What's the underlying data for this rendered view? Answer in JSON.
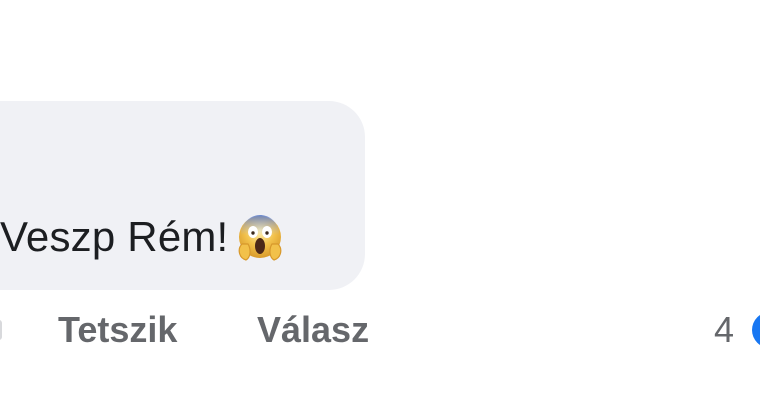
{
  "comment": {
    "text": "Veszp Rém!",
    "emoji_icon": "face-screaming-in-fear-icon"
  },
  "actions": {
    "like_label": "Tetszik",
    "reply_label": "Válasz"
  },
  "reactions": {
    "count": "4",
    "icon": "like-reaction-icon",
    "icon_color": "#1877f2"
  },
  "colors": {
    "bubble_bg": "#f0f1f5",
    "text": "#1c1e21",
    "muted": "#65676b"
  }
}
